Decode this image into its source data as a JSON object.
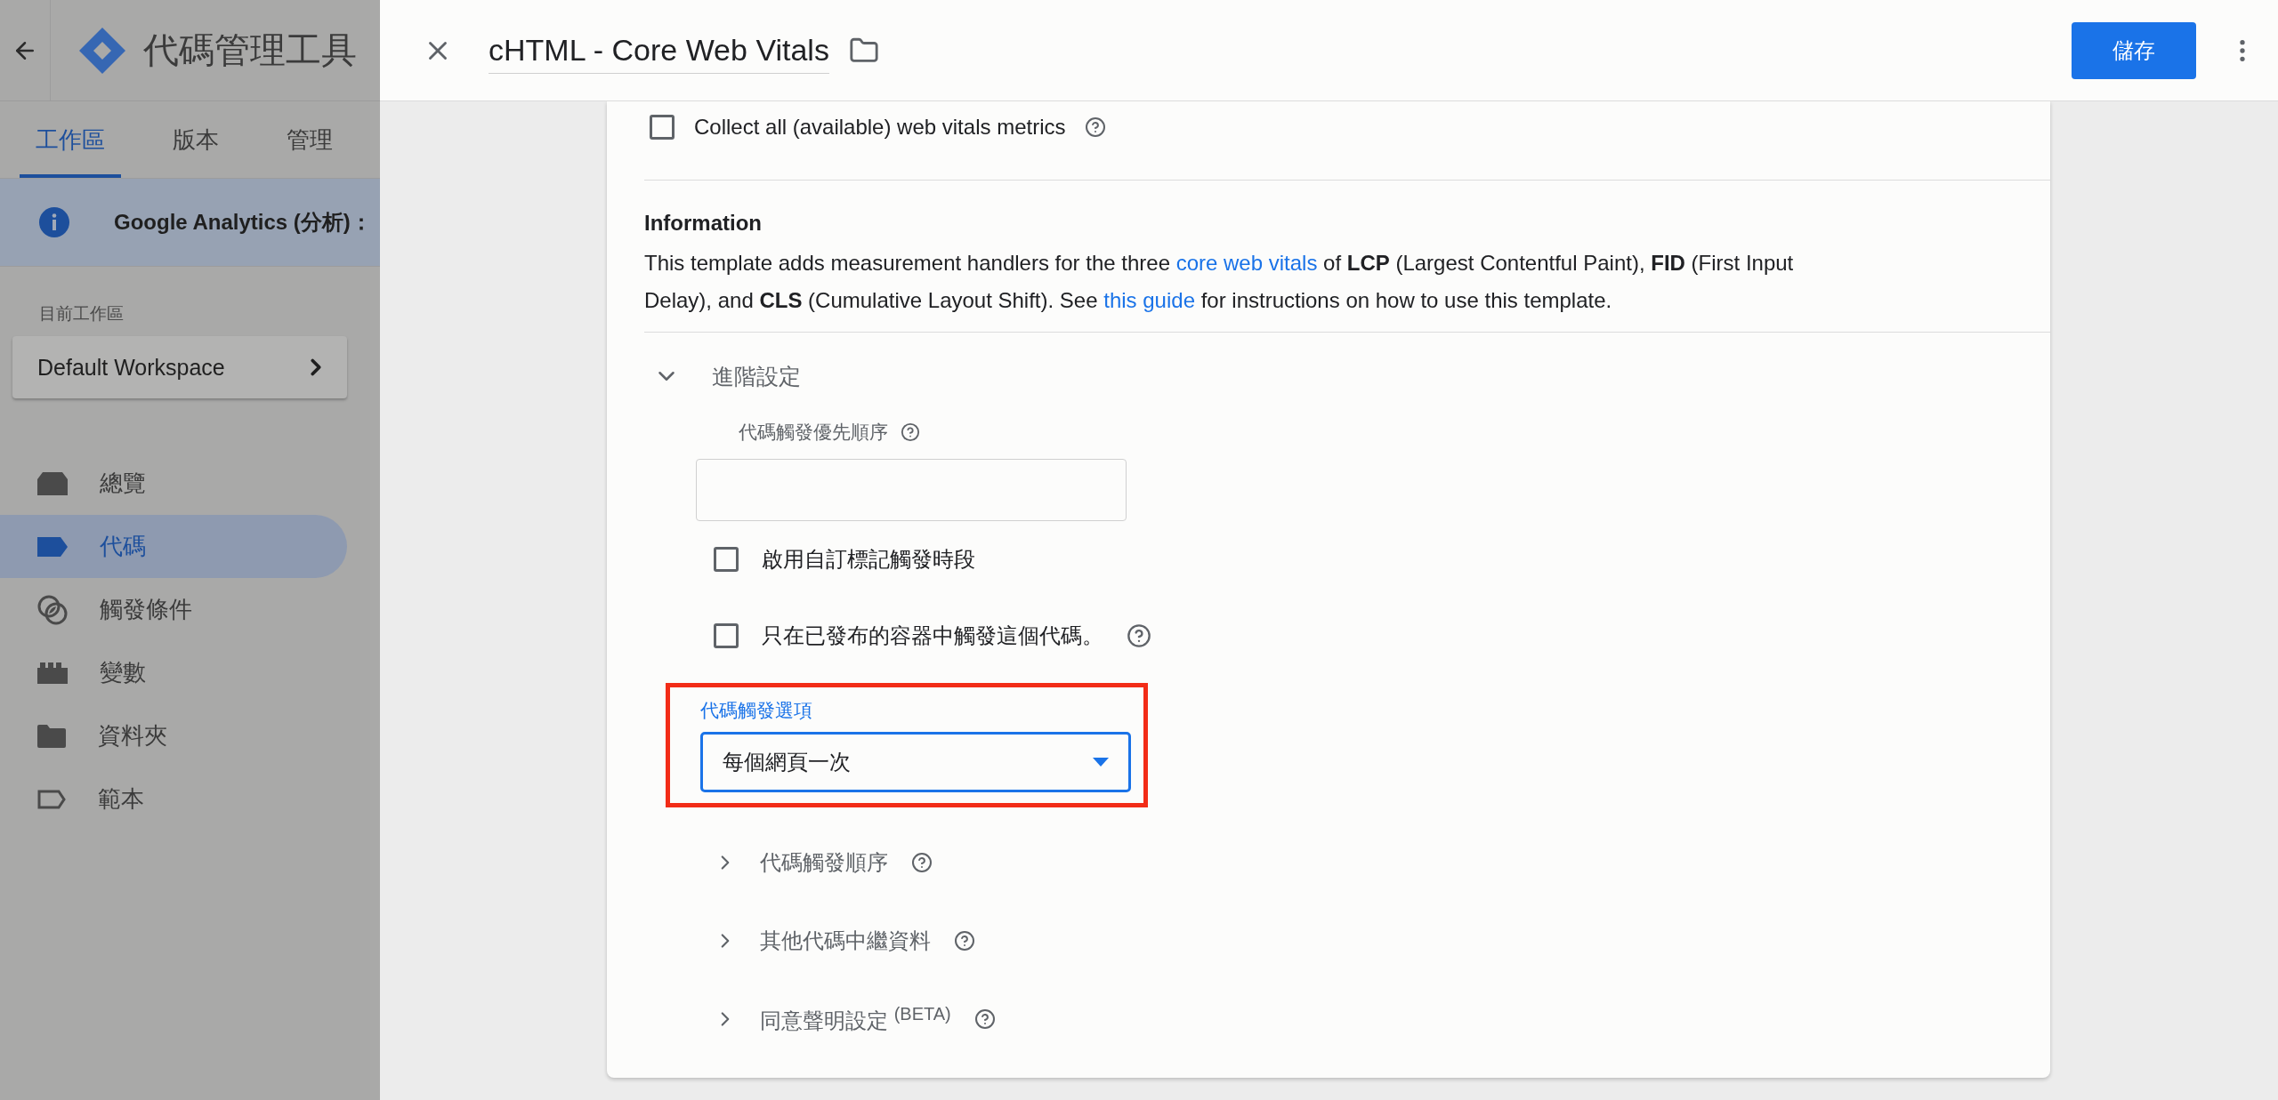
{
  "sidebar": {
    "app_title": "代碼管理工具",
    "tabs": [
      {
        "label": "工作區",
        "selected": true
      },
      {
        "label": "版本",
        "selected": false
      },
      {
        "label": "管理",
        "selected": false
      }
    ],
    "banner": "Google Analytics (分析)：",
    "workspace_label": "目前工作區",
    "workspace": "Default Workspace",
    "nav": [
      {
        "label": "總覽",
        "selected": false
      },
      {
        "label": "代碼",
        "selected": true
      },
      {
        "label": "觸發條件",
        "selected": false
      },
      {
        "label": "變數",
        "selected": false
      },
      {
        "label": "資料夾",
        "selected": false
      },
      {
        "label": "範本",
        "selected": false
      }
    ]
  },
  "panel": {
    "title": "cHTML - Core Web Vitals",
    "save": "儲存"
  },
  "card": {
    "collect": {
      "label": "Collect all (available) web vitals metrics",
      "checked": false
    },
    "info_title": "Information",
    "info_text": [
      {
        "kind": "text",
        "text": "This template adds measurement handlers for the three "
      },
      {
        "kind": "link",
        "text": "core web vitals"
      },
      {
        "kind": "text",
        "text": " of **LCP** (Largest Contentful Paint), **FID** (First Input Delay), and **CLS** (Cumulative Layout Shift). See "
      },
      {
        "kind": "link",
        "text": "this guide"
      },
      {
        "kind": "text",
        "text": " for instructions on how to use this template."
      }
    ],
    "advanced": {
      "label": "進階設定",
      "expanded": true,
      "priority_label": "代碼觸發優先順序",
      "checkboxes": [
        {
          "label": "啟用自訂標記觸發時段",
          "checked": false,
          "help": false
        },
        {
          "label": "只在已發布的容器中觸發這個代碼。",
          "checked": false,
          "help": true
        }
      ],
      "firing_option": {
        "label": "代碼觸發選項",
        "value": "每個網頁一次",
        "highlighted": true
      },
      "sections": [
        {
          "label": "代碼觸發順序",
          "expanded": false
        },
        {
          "label": "其他代碼中繼資料",
          "expanded": false
        },
        {
          "label": "同意聲明設定 $^{(BETA)}$",
          "expanded": false
        }
      ]
    }
  }
}
